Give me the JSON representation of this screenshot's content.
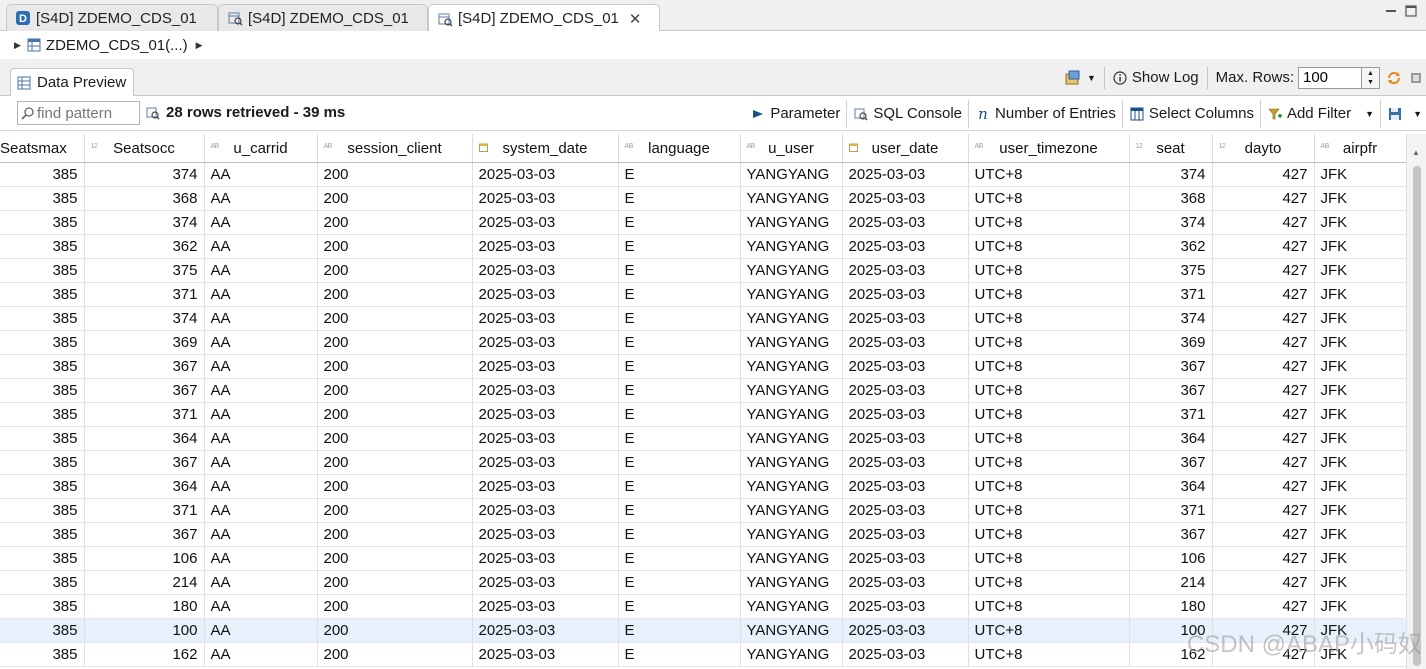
{
  "tabs": [
    {
      "label": "[S4D] ZDEMO_CDS_01",
      "icon": "ddl-source-icon",
      "active": false
    },
    {
      "label": "[S4D] ZDEMO_CDS_01",
      "icon": "data-preview-icon",
      "active": false
    },
    {
      "label": "[S4D] ZDEMO_CDS_01",
      "icon": "data-preview-icon",
      "active": true
    }
  ],
  "tab_close": "✕",
  "breadcrumb": {
    "label": "ZDEMO_CDS_01(...)"
  },
  "view": {
    "tab_label": "Data Preview",
    "show_log": "Show Log",
    "max_rows_label": "Max. Rows:",
    "max_rows_value": "100"
  },
  "filter": {
    "find_placeholder": "find pattern",
    "rows_info": "28 rows retrieved - 39 ms",
    "parameter": "Parameter",
    "sql_console": "SQL Console",
    "number_of_entries": "Number of Entries",
    "select_columns": "Select Columns",
    "add_filter": "Add Filter"
  },
  "grid": {
    "columns": [
      {
        "key": "seatsmax",
        "label": "Seatsmax",
        "type": "",
        "num": true
      },
      {
        "key": "seatsocc",
        "label": "Seatsocc",
        "type": "12",
        "num": true
      },
      {
        "key": "u_carrid",
        "label": "u_carrid",
        "type": "AB",
        "num": false
      },
      {
        "key": "session_client",
        "label": "session_client",
        "type": "AB",
        "num": false
      },
      {
        "key": "system_date",
        "label": "system_date",
        "type": "date",
        "num": false
      },
      {
        "key": "language",
        "label": "language",
        "type": "AB",
        "num": false
      },
      {
        "key": "u_user",
        "label": "u_user",
        "type": "AB",
        "num": false
      },
      {
        "key": "user_date",
        "label": "user_date",
        "type": "date",
        "num": false
      },
      {
        "key": "user_timezone",
        "label": "user_timezone",
        "type": "AB",
        "num": false
      },
      {
        "key": "seat",
        "label": "seat",
        "type": "12",
        "num": true
      },
      {
        "key": "dayto",
        "label": "dayto",
        "type": "12",
        "num": true
      },
      {
        "key": "airpfr",
        "label": "airpfr",
        "type": "AB",
        "num": false
      }
    ],
    "rows": [
      [
        "385",
        "374",
        "AA",
        "200",
        "2025-03-03",
        "E",
        "YANGYANG",
        "2025-03-03",
        "UTC+8",
        "374",
        "427",
        "JFK"
      ],
      [
        "385",
        "368",
        "AA",
        "200",
        "2025-03-03",
        "E",
        "YANGYANG",
        "2025-03-03",
        "UTC+8",
        "368",
        "427",
        "JFK"
      ],
      [
        "385",
        "374",
        "AA",
        "200",
        "2025-03-03",
        "E",
        "YANGYANG",
        "2025-03-03",
        "UTC+8",
        "374",
        "427",
        "JFK"
      ],
      [
        "385",
        "362",
        "AA",
        "200",
        "2025-03-03",
        "E",
        "YANGYANG",
        "2025-03-03",
        "UTC+8",
        "362",
        "427",
        "JFK"
      ],
      [
        "385",
        "375",
        "AA",
        "200",
        "2025-03-03",
        "E",
        "YANGYANG",
        "2025-03-03",
        "UTC+8",
        "375",
        "427",
        "JFK"
      ],
      [
        "385",
        "371",
        "AA",
        "200",
        "2025-03-03",
        "E",
        "YANGYANG",
        "2025-03-03",
        "UTC+8",
        "371",
        "427",
        "JFK"
      ],
      [
        "385",
        "374",
        "AA",
        "200",
        "2025-03-03",
        "E",
        "YANGYANG",
        "2025-03-03",
        "UTC+8",
        "374",
        "427",
        "JFK"
      ],
      [
        "385",
        "369",
        "AA",
        "200",
        "2025-03-03",
        "E",
        "YANGYANG",
        "2025-03-03",
        "UTC+8",
        "369",
        "427",
        "JFK"
      ],
      [
        "385",
        "367",
        "AA",
        "200",
        "2025-03-03",
        "E",
        "YANGYANG",
        "2025-03-03",
        "UTC+8",
        "367",
        "427",
        "JFK"
      ],
      [
        "385",
        "367",
        "AA",
        "200",
        "2025-03-03",
        "E",
        "YANGYANG",
        "2025-03-03",
        "UTC+8",
        "367",
        "427",
        "JFK"
      ],
      [
        "385",
        "371",
        "AA",
        "200",
        "2025-03-03",
        "E",
        "YANGYANG",
        "2025-03-03",
        "UTC+8",
        "371",
        "427",
        "JFK"
      ],
      [
        "385",
        "364",
        "AA",
        "200",
        "2025-03-03",
        "E",
        "YANGYANG",
        "2025-03-03",
        "UTC+8",
        "364",
        "427",
        "JFK"
      ],
      [
        "385",
        "367",
        "AA",
        "200",
        "2025-03-03",
        "E",
        "YANGYANG",
        "2025-03-03",
        "UTC+8",
        "367",
        "427",
        "JFK"
      ],
      [
        "385",
        "364",
        "AA",
        "200",
        "2025-03-03",
        "E",
        "YANGYANG",
        "2025-03-03",
        "UTC+8",
        "364",
        "427",
        "JFK"
      ],
      [
        "385",
        "371",
        "AA",
        "200",
        "2025-03-03",
        "E",
        "YANGYANG",
        "2025-03-03",
        "UTC+8",
        "371",
        "427",
        "JFK"
      ],
      [
        "385",
        "367",
        "AA",
        "200",
        "2025-03-03",
        "E",
        "YANGYANG",
        "2025-03-03",
        "UTC+8",
        "367",
        "427",
        "JFK"
      ],
      [
        "385",
        "106",
        "AA",
        "200",
        "2025-03-03",
        "E",
        "YANGYANG",
        "2025-03-03",
        "UTC+8",
        "106",
        "427",
        "JFK"
      ],
      [
        "385",
        "214",
        "AA",
        "200",
        "2025-03-03",
        "E",
        "YANGYANG",
        "2025-03-03",
        "UTC+8",
        "214",
        "427",
        "JFK"
      ],
      [
        "385",
        "180",
        "AA",
        "200",
        "2025-03-03",
        "E",
        "YANGYANG",
        "2025-03-03",
        "UTC+8",
        "180",
        "427",
        "JFK"
      ],
      [
        "385",
        "100",
        "AA",
        "200",
        "2025-03-03",
        "E",
        "YANGYANG",
        "2025-03-03",
        "UTC+8",
        "100",
        "427",
        "JFK"
      ],
      [
        "385",
        "162",
        "AA",
        "200",
        "2025-03-03",
        "E",
        "YANGYANG",
        "2025-03-03",
        "UTC+8",
        "162",
        "427",
        "JFK"
      ]
    ],
    "selected_row": 19
  },
  "watermark": "CSDN @ABAP小码奴",
  "colors": {
    "selected_row": "#e6f1fb",
    "accent": "#1a5aa6"
  }
}
